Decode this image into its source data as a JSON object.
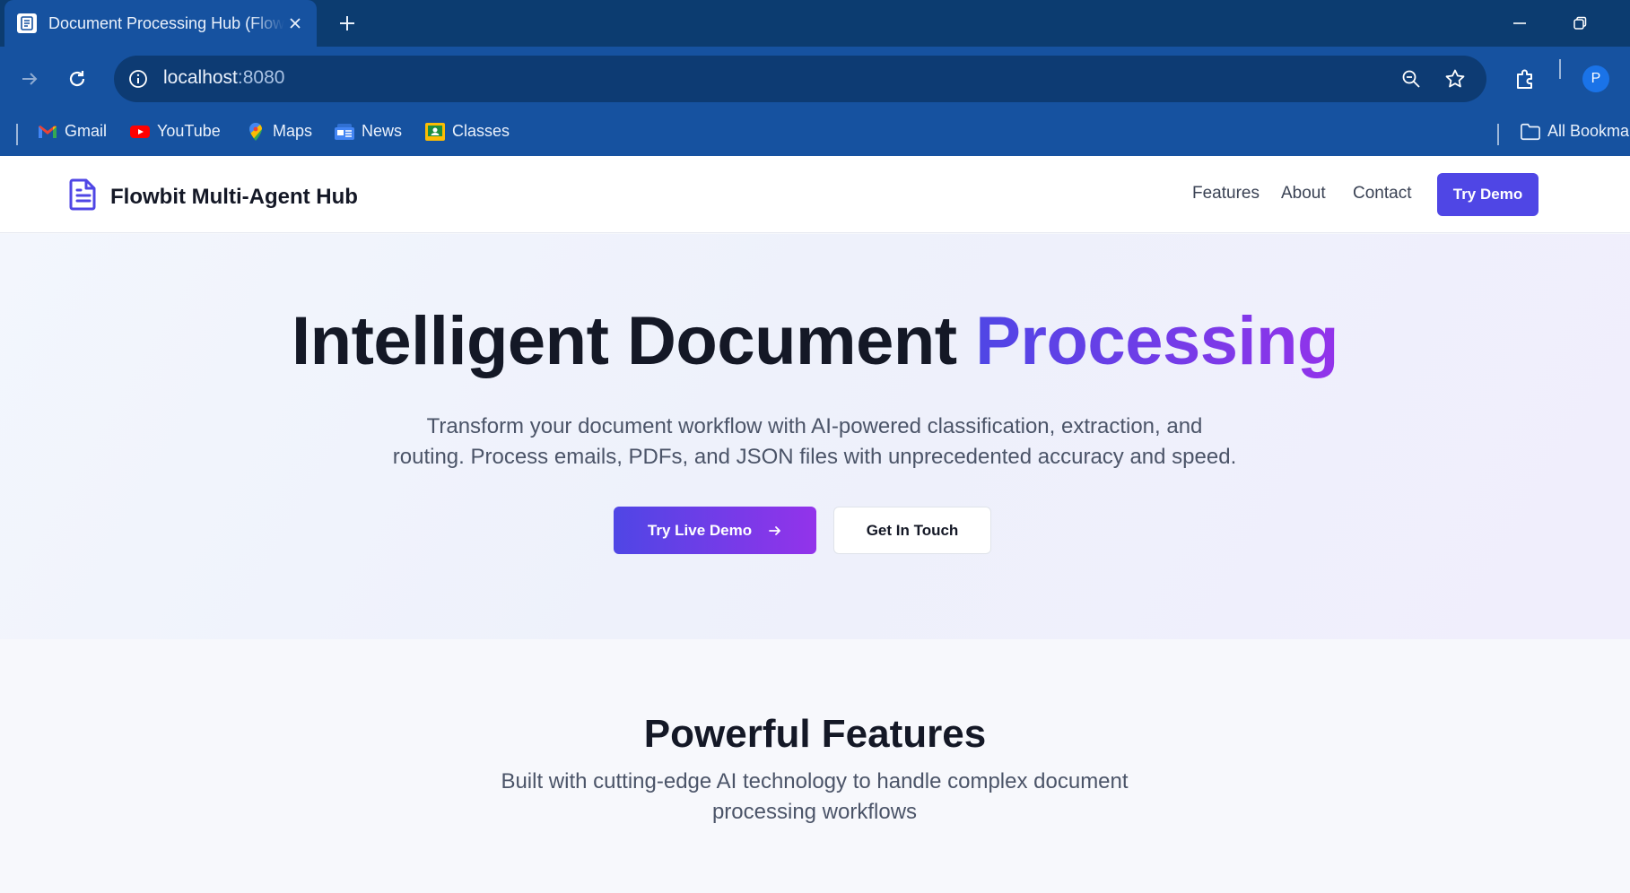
{
  "browser": {
    "tab_title": "Document Processing Hub (Flowbit Multi-Agent Hub)",
    "url_host": "localhost",
    "url_port": ":8080",
    "profile_initial": "P",
    "bookmarks": [
      {
        "label": "Gmail",
        "icon": "gmail-icon"
      },
      {
        "label": "YouTube",
        "icon": "youtube-icon"
      },
      {
        "label": "Maps",
        "icon": "maps-icon"
      },
      {
        "label": "News",
        "icon": "news-icon"
      },
      {
        "label": "Classes",
        "icon": "classes-icon"
      }
    ],
    "all_bookmarks_label": "All Bookmarks"
  },
  "site": {
    "brand": "Flowbit Multi-Agent Hub",
    "nav": {
      "features": "Features",
      "about": "About",
      "contact": "Contact",
      "cta": "Try Demo"
    }
  },
  "hero": {
    "title_main": "Intelligent Document ",
    "title_accent": "Processing",
    "subtitle_line1": "Transform your document workflow with AI-powered classification, extraction, and",
    "subtitle_line2": "routing. Process emails, PDFs, and JSON files with unprecedented accuracy and speed.",
    "primary_button": "Try Live Demo",
    "secondary_button": "Get In Touch"
  },
  "features": {
    "title": "Powerful Features",
    "subtitle_line1": "Built with cutting-edge AI technology to handle complex document",
    "subtitle_line2": "processing workflows"
  },
  "colors": {
    "chrome_dark": "#0c3c70",
    "chrome": "#1652a0",
    "brand_indigo": "#4f46e5",
    "brand_purple": "#9333ea",
    "text_dark": "#141826"
  }
}
